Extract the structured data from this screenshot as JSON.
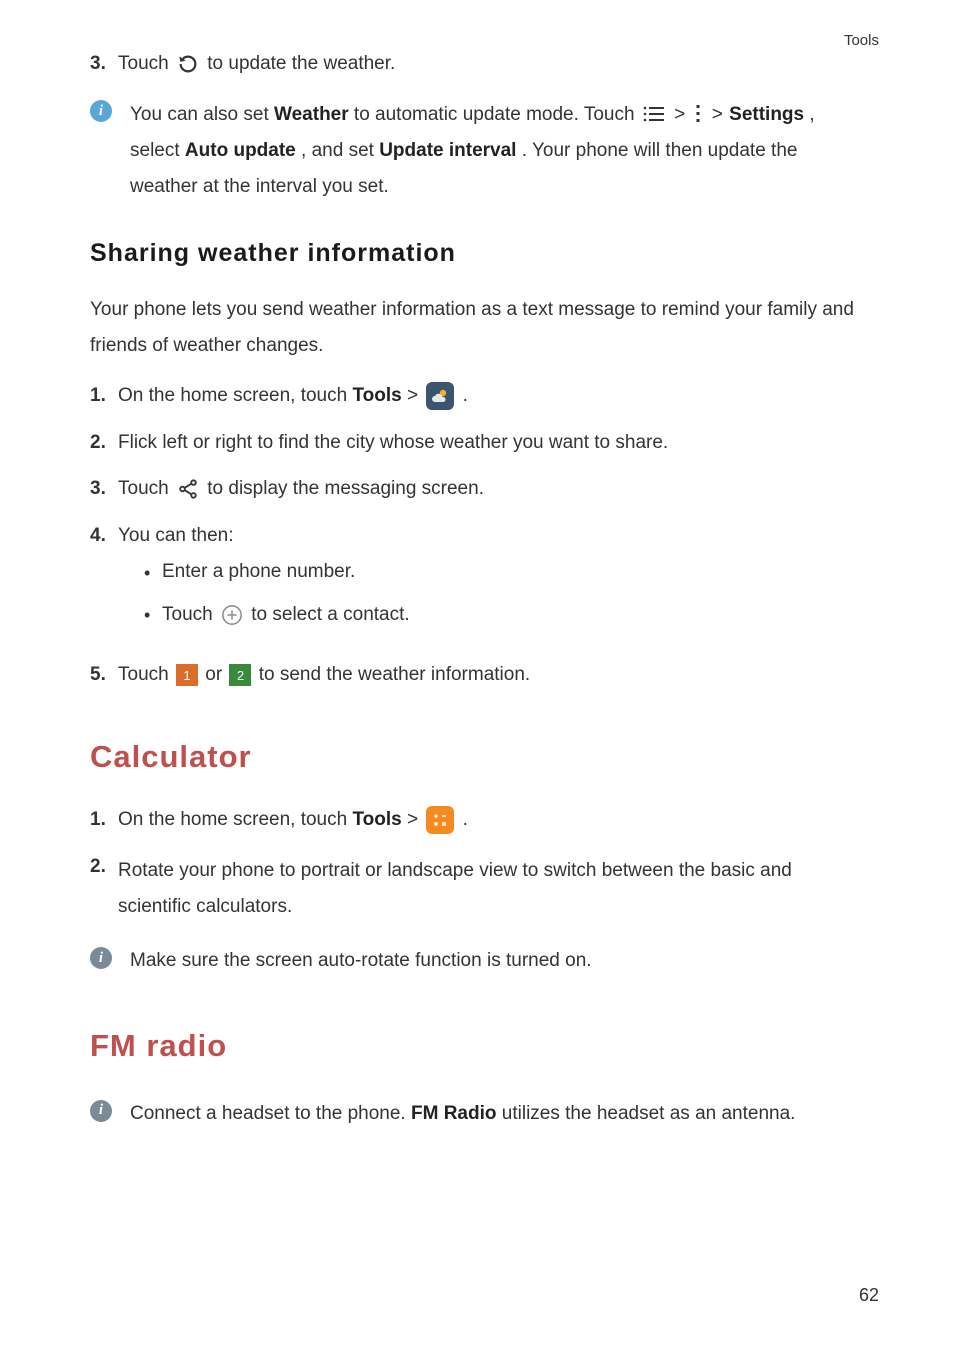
{
  "header": {
    "section": "Tools"
  },
  "footer": {
    "page": "62"
  },
  "weather": {
    "step3": {
      "num": "3.",
      "pre": "Touch ",
      "post": " to update the weather."
    },
    "tip": {
      "t1": "You can also set ",
      "bold1": "Weather",
      "t2": " to automatic update mode. Touch ",
      "t3": " > ",
      "t4": " > ",
      "bold2": "Settings",
      "t5": ", select ",
      "bold3": "Auto update",
      "t6": ", and set ",
      "bold4": "Update interval",
      "t7": ". Your phone will then update the weather at the interval you set."
    }
  },
  "sharing": {
    "heading": "Sharing weather information",
    "intro": "Your phone lets you send weather information as a text message to remind your family and friends of weather changes.",
    "s1": {
      "num": "1.",
      "a": "On the home screen, touch ",
      "b": "Tools",
      "c": " > ",
      "d": " ."
    },
    "s2": {
      "num": "2.",
      "text": "Flick left or right to find the city whose weather you want to share."
    },
    "s3": {
      "num": "3.",
      "a": "Touch ",
      "b": " to display the messaging screen."
    },
    "s4": {
      "num": "4.",
      "text": "You can then:"
    },
    "b1": "Enter a phone number.",
    "b2a": "Touch ",
    "b2b": " to select a contact.",
    "s5": {
      "num": "5.",
      "a": "Touch ",
      "sim1": "1",
      "mid": " or ",
      "sim2": "2",
      "b": " to send the weather information."
    }
  },
  "calculator": {
    "heading": "Calculator",
    "s1": {
      "num": "1.",
      "a": "On the home screen, touch ",
      "b": "Tools",
      "c": " > ",
      "d": " ."
    },
    "s2": {
      "num": "2.",
      "text": "Rotate your phone to portrait or landscape view to switch between the basic and scientific calculators."
    },
    "tip": "Make sure the screen auto-rotate function is turned on."
  },
  "fmradio": {
    "heading": "FM radio",
    "tip_a": "Connect a headset to the phone. ",
    "tip_bold": "FM Radio",
    "tip_b": " utilizes the headset as an antenna."
  }
}
